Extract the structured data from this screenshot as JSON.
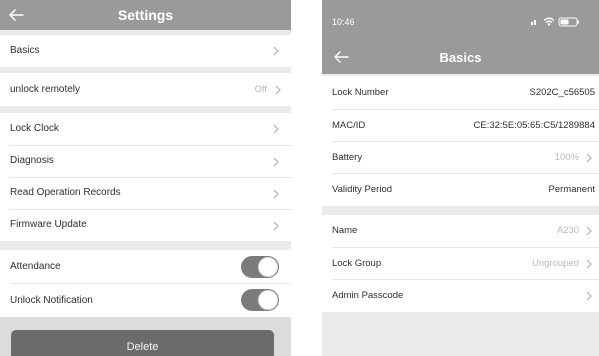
{
  "settings_screen": {
    "header": {
      "title": "Settings",
      "back_icon": "arrow-left-icon"
    },
    "basics": {
      "label": "Basics"
    },
    "unlock_remotely": {
      "label": "unlock remotely",
      "value": "Off"
    },
    "items": [
      {
        "label": "Lock Clock"
      },
      {
        "label": "Diagnosis"
      },
      {
        "label": "Read Operation Records"
      },
      {
        "label": "Firmware Update"
      }
    ],
    "toggles": [
      {
        "label": "Attendance",
        "on": true
      },
      {
        "label": "Unlock Notification",
        "on": true
      }
    ],
    "delete_label": "Delete"
  },
  "basics_screen": {
    "status_bar": {
      "time": "10:46"
    },
    "header": {
      "title": "Basics",
      "back_icon": "arrow-left-icon"
    },
    "info_rows": [
      {
        "label": "Lock Number",
        "value": "S202C_c56505"
      },
      {
        "label": "MAC/ID",
        "value": "CE:32:5E:05:65:C5/1289884"
      },
      {
        "label": "Battery",
        "value": "100%"
      },
      {
        "label": "Validity Period",
        "value": "Permanent"
      }
    ],
    "edit_rows": [
      {
        "label": "Name",
        "value": "A230"
      },
      {
        "label": "Lock Group",
        "value": "Ungrouped"
      },
      {
        "label": "Admin Passcode",
        "value": ""
      }
    ]
  },
  "colors": {
    "header_gray": "#9a9a9a",
    "toggle_on": "#7c7c7c",
    "delete_button": "#6b6b6b",
    "background": "#ebebeb"
  }
}
